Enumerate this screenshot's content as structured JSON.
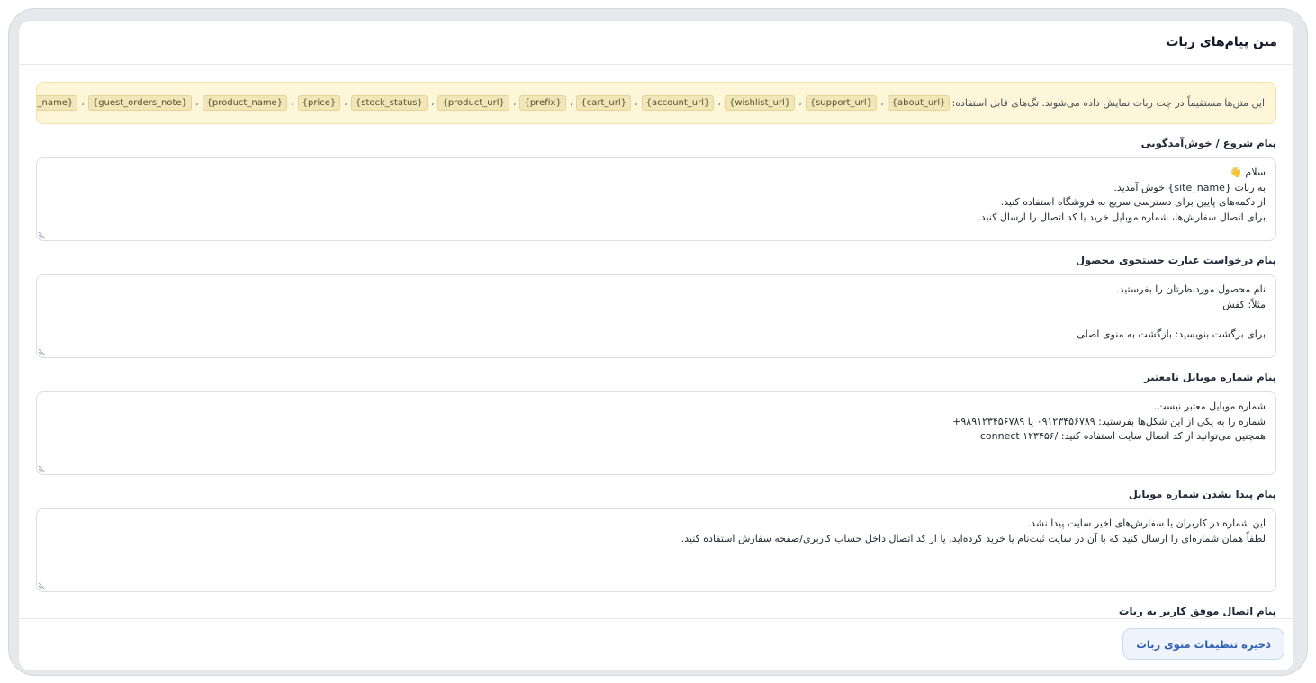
{
  "card": {
    "title": "متن پیام‌های ربات"
  },
  "notice": {
    "text": "این متن‌ها مستقیماً در چت ربات نمایش داده می‌شوند. تگ‌های قابل استفاده:",
    "tags": [
      "{about_url}",
      "{support_url}",
      "{wishlist_url}",
      "{account_url}",
      "{cart_url}",
      "{prefix}",
      "{product_url}",
      "{stock_status}",
      "{price}",
      "{product_name}",
      "{guest_orders_note}",
      "{site_name}"
    ],
    "separator": "،"
  },
  "fields": [
    {
      "label": "پیام شروع / خوش‌آمدگویی",
      "value": "سلام 👋\nبه ربات {site_name} خوش آمدید.\nاز دکمه‌های پایین برای دسترسی سریع به فروشگاه استفاده کنید.\nبرای اتصال سفارش‌ها، شماره موبایل خرید یا کد اتصال را ارسال کنید."
    },
    {
      "label": "پیام درخواست عبارت جستجوی محصول",
      "value": "نام محصول موردنظرتان را بفرستید.\nمثلاً: کفش\n\nبرای برگشت بنویسید: بازگشت به منوی اصلی"
    },
    {
      "label": "پیام شماره موبایل نامعتبر",
      "value": "شماره موبایل معتبر نیست.\nشماره را به یکی از این شکل‌ها بفرستید: ۰۹۱۲۳۴۵۶۷۸۹ یا ۹۸۹۱۲۳۴۵۶۷۸۹+\nهمچنین می‌توانید از کد اتصال سایت استفاده کنید: /connect ۱۲۳۴۵۶"
    },
    {
      "label": "پیام پیدا نشدن شماره موبایل",
      "value": "این شماره در کاربران یا سفارش‌های اخیر سایت پیدا نشد.\nلطفاً همان شماره‌ای را ارسال کنید که با آن در سایت ثبت‌نام یا خرید کرده‌اید، یا از کد اتصال داخل حساب کاربری/صفحه سفارش استفاده کنید."
    }
  ],
  "partial_label": "پیام اتصال موفق کاربر به ربات",
  "footer": {
    "save_label": "ذخیره تنظیمات منوی ربات"
  }
}
